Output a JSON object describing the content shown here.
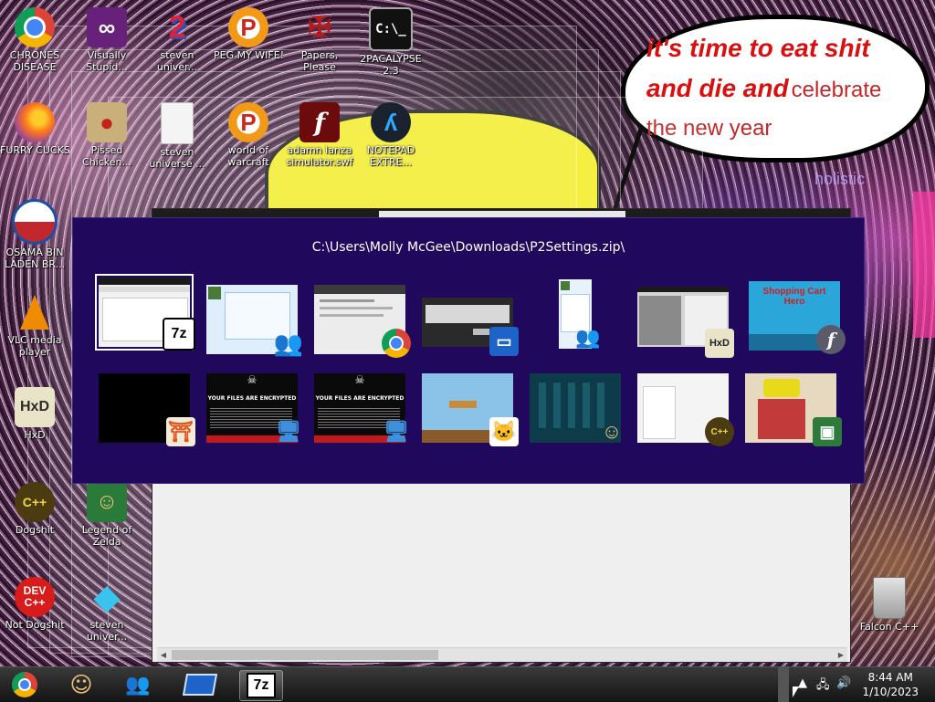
{
  "wallpaper": {
    "speech_line1": "it's time to eat shit",
    "speech_line2a": "and die and",
    "speech_line2b": "celebrate",
    "speech_line3": "the new year",
    "watermark": "holistic"
  },
  "desktop_icons": [
    {
      "label_1": "CHRONES",
      "label_2": "DISEASE",
      "icon": "chrome-icon",
      "color": "#4285f4"
    },
    {
      "label_1": "Visually",
      "label_2": "Stupid...",
      "icon": "visual-studio-icon",
      "color": "#68217a"
    },
    {
      "label_1": "steven",
      "label_2": "univer...",
      "icon": "steven-universe-2-icon",
      "color": "#1a56c4"
    },
    {
      "label_1": "PEG MY WIFE!",
      "label_2": "",
      "icon": "peggle-icon",
      "color": "#f29a18"
    },
    {
      "label_1": "Papers,",
      "label_2": "Please",
      "icon": "papers-please-icon",
      "color": "#8b1d1d"
    },
    {
      "label_1": "2PACALYPSE",
      "label_2": "2.3",
      "icon": "terminal-icon",
      "color": "#111111"
    },
    {
      "label_1": "FURRY CUCKS",
      "label_2": "",
      "icon": "firefox-icon",
      "color": "#ff7a1a"
    },
    {
      "label_1": "Pissed",
      "label_2": "Chicken...",
      "icon": "angry-birds-icon",
      "color": "#c9b07a"
    },
    {
      "label_1": "steven",
      "label_2": "universe ...",
      "icon": "blank-file-icon",
      "color": "#eeeeee"
    },
    {
      "label_1": "world of",
      "label_2": "warcraft",
      "icon": "peggle-icon",
      "color": "#f29a18"
    },
    {
      "label_1": "adamn lanza",
      "label_2": "simulator.swf",
      "icon": "flash-icon",
      "color": "#6b0b0b"
    },
    {
      "label_1": "NOTEPAD",
      "label_2": "EXTRE...",
      "icon": "notepad-extreme-icon",
      "color": "#1a2230"
    },
    {
      "label_1": "OSAMA BIN",
      "label_2": "LADEN BR...",
      "icon": "obama-logo-icon",
      "color": "#1b4fa3"
    },
    {
      "label_1": "VLC media",
      "label_2": "player",
      "icon": "vlc-cone-icon",
      "color": "#f08a00"
    },
    {
      "label_1": "HxD",
      "label_2": "",
      "icon": "hxd-icon",
      "color": "#e9e3c8"
    },
    {
      "label_1": "Dogshit",
      "label_2": "",
      "icon": "dogshit-icon",
      "color": "#4a3b10"
    },
    {
      "label_1": "Legend of",
      "label_2": "Zelda",
      "icon": "zelda-sprite-icon",
      "color": "#2a7a3a"
    },
    {
      "label_1": "Not Dogshit",
      "label_2": "",
      "icon": "dev-cpp-icon",
      "color": "#d81b1b"
    },
    {
      "label_1": "steven",
      "label_2": "univer...",
      "icon": "diamond-icon",
      "color": "#39c4f0"
    },
    {
      "label_1": "Falcon C++",
      "label_2": "",
      "icon": "recycle-bin-icon",
      "color": "#c8c8c8"
    }
  ],
  "switcher": {
    "title": "C:\\Users\\Molly McGee\\Downloads\\P2Settings.zip\\",
    "badge_7z": "7z",
    "badge_hxd": "HxD",
    "thumb_ransom_text": "YOUR FILES ARE ENCRYPTED",
    "thumb_cart_text": "Shopping Cart Hero",
    "row1": [
      {
        "name": "7zip-window",
        "badge": "7z-icon",
        "bg": "#f2f2f2"
      },
      {
        "name": "messenger-window",
        "badge": "messenger-icon",
        "bg": "#dfeefc"
      },
      {
        "name": "chrome-window",
        "badge": "chrome-icon",
        "bg": "#ececec"
      },
      {
        "name": "dialog-window",
        "badge": "monitor-icon",
        "bg": "#2a2a2a"
      },
      {
        "name": "messenger-small-window",
        "badge": "messenger-icon",
        "bg": "#e8f2fb"
      },
      {
        "name": "hxd-window",
        "badge": "hxd-icon",
        "bg": "#d4d4d4"
      },
      {
        "name": "flash-game-window",
        "badge": "flash-icon",
        "bg": "#2aa6d8"
      }
    ],
    "row2": [
      {
        "name": "black-window",
        "badge": "torii-icon",
        "bg": "#000000"
      },
      {
        "name": "ransom-window-1",
        "badge": "remote-icon",
        "bg": "#0a0a0a"
      },
      {
        "name": "ransom-window-2",
        "badge": "remote-icon",
        "bg": "#0a0a0a"
      },
      {
        "name": "platformer-window",
        "badge": "cat-sprite-icon",
        "bg": "#8bc3e8"
      },
      {
        "name": "zelda-game-window",
        "badge": "zelda-sprite-icon",
        "bg": "#0d3b4a"
      },
      {
        "name": "blank-app-window",
        "badge": "dogshit-icon",
        "bg": "#f4f4f4"
      },
      {
        "name": "meme-window",
        "badge": "image-viewer-icon",
        "bg": "#e7d8c0"
      }
    ]
  },
  "taskbar": {
    "buttons": [
      {
        "name": "chrome-taskbar-button",
        "icon": "chrome-icon",
        "active": false
      },
      {
        "name": "zelda-taskbar-button",
        "icon": "zelda-sprite-icon",
        "active": false
      },
      {
        "name": "messenger-taskbar-button",
        "icon": "messenger-icon",
        "active": false
      },
      {
        "name": "remote-taskbar-button",
        "icon": "monitor-icon",
        "active": false
      },
      {
        "name": "7zip-taskbar-button",
        "icon": "7z-icon",
        "active": true
      }
    ],
    "time": "8:44 AM",
    "date": "1/10/2023"
  }
}
